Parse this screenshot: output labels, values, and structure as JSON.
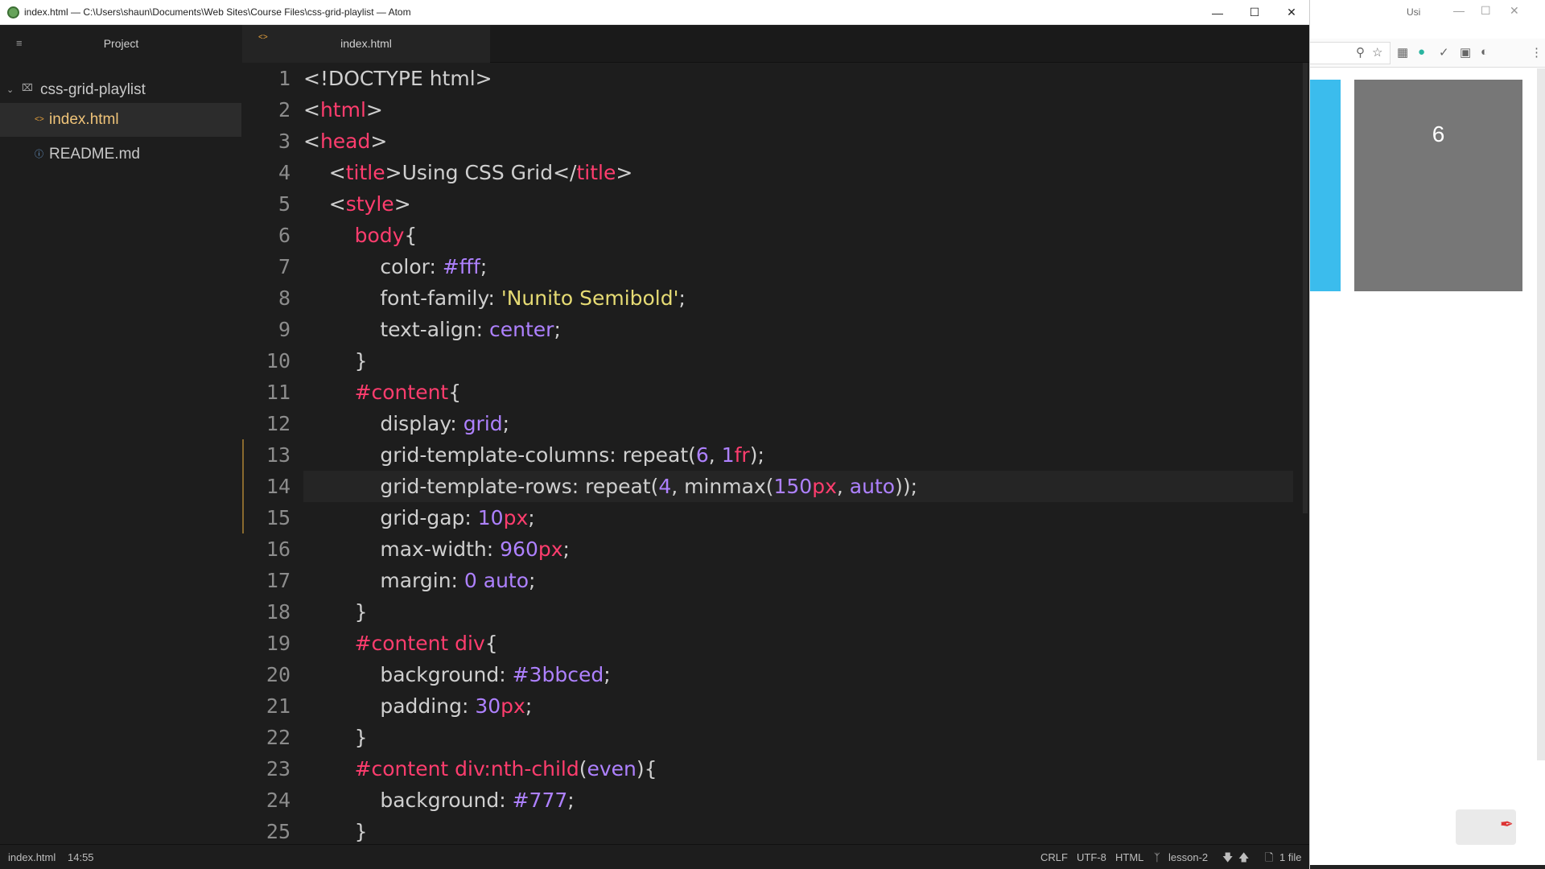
{
  "window": {
    "title": "index.html — C:\\Users\\shaun\\Documents\\Web Sites\\Course Files\\css-grid-playlist — Atom",
    "icon": "atom-icon",
    "controls": [
      "minimize-icon",
      "maximize-icon",
      "close-icon"
    ]
  },
  "tree": {
    "menu_icon": "≡",
    "title": "Project",
    "root": "css-grid-playlist",
    "files": [
      {
        "name": "index.html",
        "selected": true
      },
      {
        "name": "README.md",
        "selected": false
      }
    ]
  },
  "tabs": [
    {
      "label": "index.html",
      "active": true
    }
  ],
  "editor": {
    "active_line": 14,
    "lines": [
      {
        "n": "1"
      },
      {
        "n": "2"
      },
      {
        "n": "3"
      },
      {
        "n": "4"
      },
      {
        "n": "5"
      },
      {
        "n": "6"
      },
      {
        "n": "7"
      },
      {
        "n": "8"
      },
      {
        "n": "9"
      },
      {
        "n": "10"
      },
      {
        "n": "11"
      },
      {
        "n": "12"
      },
      {
        "n": "13"
      },
      {
        "n": "14"
      },
      {
        "n": "15"
      },
      {
        "n": "16"
      },
      {
        "n": "17"
      },
      {
        "n": "18"
      },
      {
        "n": "19"
      },
      {
        "n": "20"
      },
      {
        "n": "21"
      },
      {
        "n": "22"
      },
      {
        "n": "23"
      },
      {
        "n": "24"
      },
      {
        "n": "25"
      }
    ],
    "code": [
      [
        {
          "c": "p",
          "t": "<!DOCTYPE html>"
        }
      ],
      [
        {
          "c": "p",
          "t": "<"
        },
        {
          "c": "t",
          "t": "html"
        },
        {
          "c": "p",
          "t": ">"
        }
      ],
      [
        {
          "c": "p",
          "t": "<"
        },
        {
          "c": "t",
          "t": "head"
        },
        {
          "c": "p",
          "t": ">"
        }
      ],
      [
        {
          "c": "p",
          "t": "    <"
        },
        {
          "c": "t",
          "t": "title"
        },
        {
          "c": "p",
          "t": ">Using CSS Grid</"
        },
        {
          "c": "t",
          "t": "title"
        },
        {
          "c": "p",
          "t": ">"
        }
      ],
      [
        {
          "c": "p",
          "t": "    <"
        },
        {
          "c": "t",
          "t": "style"
        },
        {
          "c": "p",
          "t": ">"
        }
      ],
      [
        {
          "c": "k",
          "t": "        body"
        },
        {
          "c": "p",
          "t": "{"
        }
      ],
      [
        {
          "c": "p",
          "t": "            color: "
        },
        {
          "c": "n",
          "t": "#fff"
        },
        {
          "c": "p",
          "t": ";"
        }
      ],
      [
        {
          "c": "p",
          "t": "            font-family: "
        },
        {
          "c": "s",
          "t": "'Nunito Semibold'"
        },
        {
          "c": "p",
          "t": ";"
        }
      ],
      [
        {
          "c": "p",
          "t": "            text-align: "
        },
        {
          "c": "n",
          "t": "center"
        },
        {
          "c": "p",
          "t": ";"
        }
      ],
      [
        {
          "c": "p",
          "t": "        }"
        }
      ],
      [
        {
          "c": "k",
          "t": "        #content"
        },
        {
          "c": "p",
          "t": "{"
        }
      ],
      [
        {
          "c": "p",
          "t": "            display: "
        },
        {
          "c": "n",
          "t": "grid"
        },
        {
          "c": "p",
          "t": ";"
        }
      ],
      [
        {
          "c": "p",
          "t": "            grid-template-columns: repeat("
        },
        {
          "c": "n",
          "t": "6"
        },
        {
          "c": "p",
          "t": ", "
        },
        {
          "c": "n",
          "t": "1"
        },
        {
          "c": "u",
          "t": "fr"
        },
        {
          "c": "p",
          "t": ");"
        }
      ],
      [
        {
          "c": "p",
          "t": "            grid-template-rows: repeat("
        },
        {
          "c": "n",
          "t": "4"
        },
        {
          "c": "p",
          "t": ", minmax("
        },
        {
          "c": "n",
          "t": "150"
        },
        {
          "c": "u",
          "t": "px"
        },
        {
          "c": "p",
          "t": ", "
        },
        {
          "c": "n",
          "t": "auto"
        },
        {
          "c": "p",
          "t": "));"
        }
      ],
      [
        {
          "c": "p",
          "t": "            grid-gap: "
        },
        {
          "c": "n",
          "t": "10"
        },
        {
          "c": "u",
          "t": "px"
        },
        {
          "c": "p",
          "t": ";"
        }
      ],
      [
        {
          "c": "p",
          "t": "            max-width: "
        },
        {
          "c": "n",
          "t": "960"
        },
        {
          "c": "u",
          "t": "px"
        },
        {
          "c": "p",
          "t": ";"
        }
      ],
      [
        {
          "c": "p",
          "t": "            margin: "
        },
        {
          "c": "n",
          "t": "0"
        },
        {
          "c": "p",
          "t": " "
        },
        {
          "c": "n",
          "t": "auto"
        },
        {
          "c": "p",
          "t": ";"
        }
      ],
      [
        {
          "c": "p",
          "t": "        }"
        }
      ],
      [
        {
          "c": "k",
          "t": "        #content div"
        },
        {
          "c": "p",
          "t": "{"
        }
      ],
      [
        {
          "c": "p",
          "t": "            background: "
        },
        {
          "c": "n",
          "t": "#3bbced"
        },
        {
          "c": "p",
          "t": ";"
        }
      ],
      [
        {
          "c": "p",
          "t": "            padding: "
        },
        {
          "c": "n",
          "t": "30"
        },
        {
          "c": "u",
          "t": "px"
        },
        {
          "c": "p",
          "t": ";"
        }
      ],
      [
        {
          "c": "p",
          "t": "        }"
        }
      ],
      [
        {
          "c": "k",
          "t": "        #content div:nth-child"
        },
        {
          "c": "p",
          "t": "("
        },
        {
          "c": "n",
          "t": "even"
        },
        {
          "c": "p",
          "t": "){"
        }
      ],
      [
        {
          "c": "p",
          "t": "            background: "
        },
        {
          "c": "n",
          "t": "#777"
        },
        {
          "c": "p",
          "t": ";"
        }
      ],
      [
        {
          "c": "p",
          "t": "        }"
        }
      ]
    ]
  },
  "statusbar": {
    "file": "index.html",
    "cursor": "14:55",
    "line_ending": "CRLF",
    "encoding": "UTF-8",
    "grammar": "HTML",
    "branch": "lesson-2",
    "changes": "1 file"
  },
  "browser": {
    "tab_title": "Usi",
    "grid_cell_label": "6",
    "colors": {
      "blue": "#3bbced",
      "grey": "#777"
    }
  },
  "colors": {
    "keyword": "#ff3d6e",
    "number": "#ae81ff",
    "string": "#e6db74",
    "text": "#cfcfcf",
    "background": "#1d1d1d"
  }
}
